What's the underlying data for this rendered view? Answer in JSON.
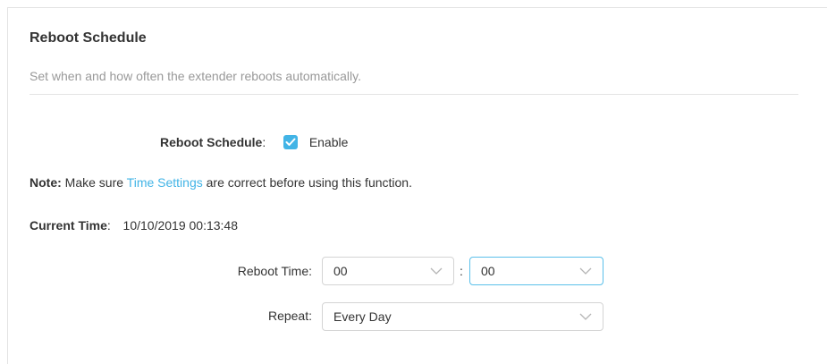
{
  "section": {
    "title": "Reboot Schedule",
    "description": "Set when and how often the extender reboots automatically."
  },
  "reboot_schedule": {
    "label": "Reboot Schedule",
    "colon": ":",
    "checkbox_label": "Enable",
    "enabled": true
  },
  "note": {
    "prefix": "Note:",
    "text_before": " Make sure ",
    "link": "Time Settings",
    "text_after": " are correct before using this function."
  },
  "current_time": {
    "label": "Current Time",
    "colon": ":",
    "value": "10/10/2019 00:13:48"
  },
  "reboot_time": {
    "label": "Reboot Time:",
    "hour": "00",
    "separator": ":",
    "minute": "00"
  },
  "repeat": {
    "label": "Repeat:",
    "value": "Every Day"
  },
  "colors": {
    "accent": "#42b4e6",
    "muted_text": "#999999",
    "border": "#d4d4d4"
  }
}
